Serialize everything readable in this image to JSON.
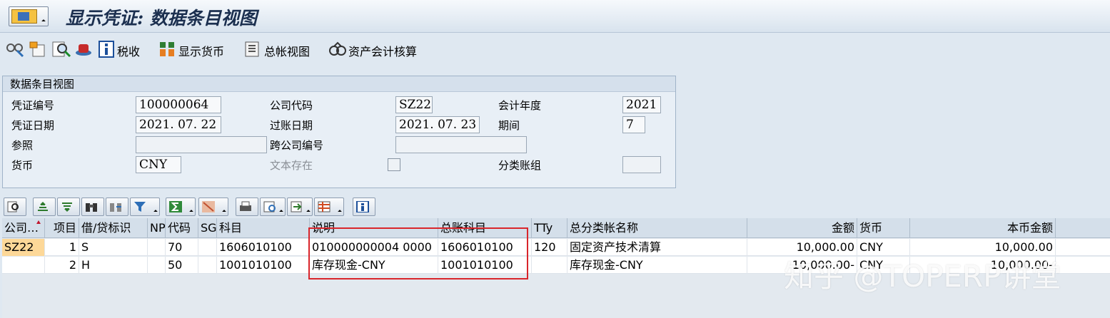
{
  "window": {
    "title": "显示凭证: 数据条目视图"
  },
  "app_toolbar": {
    "items": [
      {
        "icon": "glasses-icon"
      },
      {
        "icon": "document-change-icon"
      },
      {
        "icon": "document-search-icon"
      },
      {
        "icon": "hat-icon"
      },
      {
        "icon": "info-icon",
        "label": "税收"
      },
      {
        "icon": "currency-icon",
        "label": "显示货币"
      },
      {
        "icon": "ledger-icon",
        "label": "总帐视图"
      },
      {
        "icon": "asset-icon",
        "label": "资产会计核算"
      }
    ]
  },
  "header": {
    "group_title": "数据条目视图",
    "doc_number": {
      "label": "凭证编号",
      "value": "100000064"
    },
    "company_code": {
      "label": "公司代码",
      "value": "SZ22"
    },
    "fiscal_year": {
      "label": "会计年度",
      "value": "2021"
    },
    "doc_date": {
      "label": "凭证日期",
      "value": "2021. 07. 22"
    },
    "posting_date": {
      "label": "过账日期",
      "value": "2021. 07. 23"
    },
    "period": {
      "label": "期间",
      "value": "7"
    },
    "reference": {
      "label": "参照",
      "value": ""
    },
    "cross_company": {
      "label": "跨公司编号",
      "value": ""
    },
    "currency": {
      "label": "货币",
      "value": "CNY"
    },
    "text_exists": {
      "label": "文本存在",
      "checked": false
    },
    "ledger_group": {
      "label": "分类账组",
      "value": ""
    }
  },
  "table": {
    "columns": [
      "公司…",
      "项目",
      "借/贷标识",
      "NP",
      "代码",
      "SG",
      "科目",
      "说明",
      "总账科目",
      "TTy",
      "总分类帐名称",
      "金额",
      "货币",
      "本币金额"
    ],
    "rows": [
      [
        "SZ22",
        "1",
        "S",
        "",
        "70",
        "",
        "1606010100",
        "010000000004 0000",
        "1606010100",
        "120",
        "固定资产技术清算",
        "10,000.00",
        "CNY",
        "10,000.00"
      ],
      [
        "",
        "2",
        "H",
        "",
        "50",
        "",
        "1001010100",
        "库存现金-CNY",
        "1001010100",
        "",
        "库存现金-CNY",
        "10,000.00-",
        "CNY",
        "10,000.00-"
      ]
    ]
  },
  "watermark": "知乎 @TOPERP讲堂",
  "colors": {
    "highlight": "#d9252b",
    "key_cell": "#fdd898"
  }
}
